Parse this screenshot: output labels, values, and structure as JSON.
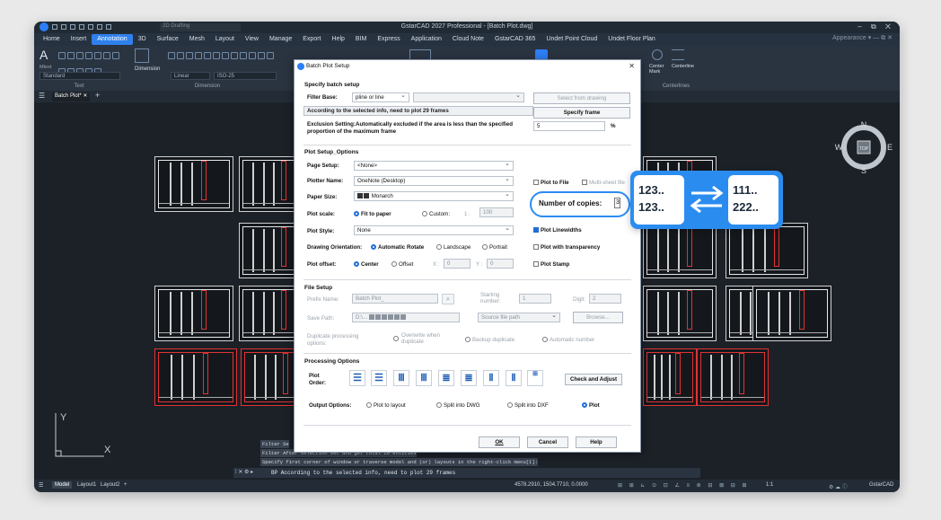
{
  "titlebar": {
    "title": "GstarCAD 2027 Professional - [Batch Plot.dwg]",
    "workspace": "2D Drafting",
    "controls": "– ⧉ ✕"
  },
  "menu": {
    "items": [
      "Home",
      "Insert",
      "Annotation",
      "3D",
      "Surface",
      "Mesh",
      "Layout",
      "View",
      "Manage",
      "Export",
      "Help",
      "BIM",
      "Express",
      "Application",
      "Cloud Note",
      "GstarCAD 365",
      "Undet Point Cloud",
      "Undet Floor Plan"
    ],
    "active": "Annotation",
    "appearance": "Appearance ▾  —  ⧉  ✕"
  },
  "ribbon": {
    "text_group": "Text",
    "dimension_group": "Dimension",
    "dimension_btn": "Dimension",
    "text_style": "Standard",
    "dim_style": "ISO-25",
    "dim_linear": "Linear",
    "mtext": "Mtext",
    "centerlines_group": "Centerlines",
    "center_mark": "Center Mark",
    "centerline": "Centerline"
  },
  "doc_tab": {
    "name": "Batch Plot*",
    "close": "✕",
    "add": "+"
  },
  "dialog": {
    "title": "Batch Plot Setup",
    "close": "✕",
    "batch": {
      "section": "Specify batch setup",
      "filter_base_label": "Filter Base:",
      "filter_base_value": "pline or line",
      "info": "According to the selected info, need to plot 29 frames",
      "select_btn": "Select from drawing",
      "specify_frame_btn": "Specify frame",
      "exclusion_text": "Exclusion Setting:Automatically excluded if the area is less than the specified proportion of the maximum frame",
      "exclusion_value": "5",
      "percent": "%"
    },
    "plot_setup": {
      "section": "Plot Setup_Options",
      "page_setup_label": "Page Setup:",
      "page_setup_value": "<None>",
      "plotter_label": "Plotter Name:",
      "plotter_value": "OneNote (Desktop)",
      "paper_label": "Paper Size:",
      "paper_value": "Monarch",
      "scale_label": "Plot scale:",
      "fit_to_paper": "Fit to paper",
      "custom": "Custom:",
      "scale_value": "100",
      "scale_prefix": "1 :",
      "style_label": "Plot Style:",
      "style_value": "None",
      "orientation_label": "Drawing Orientation:",
      "auto_rotate": "Automatic Rotate",
      "landscape": "Landscape",
      "portrait": "Portrait",
      "offset_label": "Plot offset:",
      "center": "Center",
      "offset": "Offset",
      "x_label": "X :",
      "x_value": "0",
      "y_label": "Y :",
      "y_value": "0",
      "plot_to_file": "Plot to File",
      "multi_sheet": "Multi-sheet file",
      "copies_label": "Number of copies:",
      "copies_value": "3",
      "plot_linewidths": "Plot Linewidths",
      "plot_transparency": "Plot with transparency",
      "plot_stamp": "Plot Stamp"
    },
    "file_setup": {
      "section": "File Setup",
      "prefix_label": "Prefix Name:",
      "prefix_value": "Batch Plot_",
      "starting_label": "Starting number:",
      "starting_value": "1",
      "digit_label": "Digit:",
      "digit_value": "2",
      "save_path_label": "Save Path:",
      "save_path_value": "D:\\...",
      "source_path": "Source file path",
      "browse": "Browse...",
      "dup_label": "Duplicate processing options:",
      "overwrite": "Overwrite when duplicate",
      "backup": "Backup duplicate",
      "auto_number": "Automatic number"
    },
    "processing": {
      "section": "Processing Options",
      "order_label": "Plot Order:",
      "check_adjust": "Check and Adjust",
      "output_label": "Output Options:",
      "to_layout": "Plot to layout",
      "split_dwg": "Split into DWG",
      "split_dxf": "Split into DXF",
      "plot": "Plot"
    },
    "ok": "OK",
    "cancel": "Cancel",
    "help": "Help"
  },
  "callout": {
    "left_top": "123..",
    "left_bottom": "123..",
    "right_top": "111..",
    "right_bottom": "222.."
  },
  "compass": {
    "n": "N",
    "s": "S",
    "w": "W",
    "e": "E",
    "top": "TOP"
  },
  "ucs": {
    "y": "Y",
    "x": "X"
  },
  "command": {
    "lines": [
      "Filter Se",
      "Filter After selection set and get total 29 entities",
      "Specify first corner of window or traverse model and (or) layouts in the right-click menu[I]:"
    ],
    "current": "BP According to the selected info, need to plot 29 frames"
  },
  "status": {
    "tabs": [
      "Model",
      "Layout1",
      "Layout2"
    ],
    "coords": "4578.2910, 1504.7710, 0.0000",
    "scale": "1:1",
    "app": "GstarCAD"
  }
}
